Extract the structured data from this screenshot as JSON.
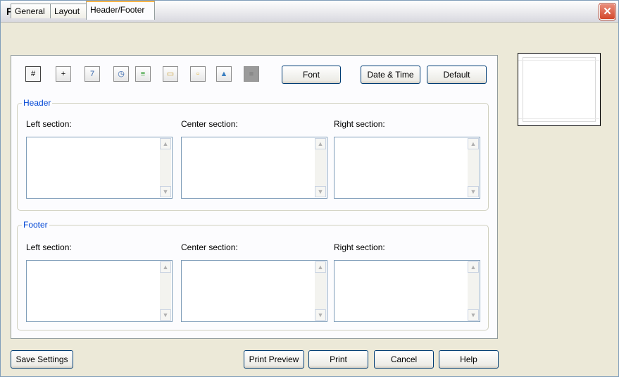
{
  "window": {
    "title": "Print",
    "close_glyph": "✕"
  },
  "tabs": [
    {
      "label": "General"
    },
    {
      "label": "Layout"
    },
    {
      "label": "Header/Footer"
    }
  ],
  "toolbar": {
    "icons": [
      {
        "name": "page-number-icon",
        "glyph": "#"
      },
      {
        "name": "total-pages-icon",
        "glyph": "+"
      },
      {
        "name": "date-icon",
        "glyph": "7"
      },
      {
        "name": "time-icon",
        "glyph": "◷"
      },
      {
        "name": "file-path-icon",
        "glyph": "≡"
      },
      {
        "name": "file-name-icon",
        "glyph": "▭"
      },
      {
        "name": "sheet-name-icon",
        "glyph": "▫"
      },
      {
        "name": "insert-picture-icon",
        "glyph": "▲"
      },
      {
        "name": "format-picture-icon",
        "glyph": "■"
      }
    ],
    "font_label": "Font",
    "datetime_label": "Date & Time",
    "default_label": "Default"
  },
  "header": {
    "legend": "Header",
    "left_label": "Left section:",
    "center_label": "Center section:",
    "right_label": "Right section:",
    "left_value": "",
    "center_value": "",
    "right_value": ""
  },
  "footer": {
    "legend": "Footer",
    "left_label": "Left section:",
    "center_label": "Center section:",
    "right_label": "Right section:",
    "left_value": "",
    "center_value": "",
    "right_value": ""
  },
  "buttons": {
    "save_settings": "Save Settings",
    "print_preview": "Print Preview",
    "print": "Print",
    "cancel": "Cancel",
    "help": "Help"
  },
  "scroll": {
    "up": "▲",
    "down": "▼"
  },
  "colors": {
    "accent_tab": "#f5b34a",
    "legend_text": "#0046d5",
    "close_button": "#d4482c"
  }
}
